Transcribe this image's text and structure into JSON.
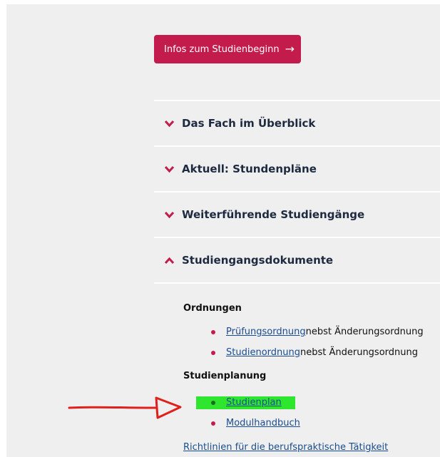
{
  "cta": {
    "label": "Infos zum Studienbeginn",
    "arrow": "→"
  },
  "accordion": [
    {
      "label": "Das Fach im Überblick",
      "expanded": false
    },
    {
      "label": "Aktuell: Stundenpläne",
      "expanded": false
    },
    {
      "label": "Weiterführende Studiengänge",
      "expanded": false
    },
    {
      "label": "Studiengangsdokumente",
      "expanded": true
    }
  ],
  "documents": {
    "ordnungen_heading": "Ordnungen",
    "ordnungen": [
      {
        "link": "Prüfungsordnung",
        "suffix": " nebst Änderungsordnung"
      },
      {
        "link": "Studienordnung",
        "suffix": " nebst Änderungsordnung"
      }
    ],
    "studienplanung_heading": "Studienplanung",
    "studienplanung": [
      {
        "link": "Studienplan"
      },
      {
        "link": "Modulhandbuch"
      }
    ],
    "richtlinien_link": "Richtlinien für die berufspraktische Tätigkeit"
  },
  "colors": {
    "accent": "#c41b4d",
    "link": "#1a4d8f",
    "highlight": "#2ee62e",
    "annotation_arrow": "#e0201c"
  },
  "icons": {
    "accordion_collapsed": "chevron-down-icon",
    "accordion_expanded": "chevron-up-icon",
    "cta": "arrow-right-icon"
  }
}
